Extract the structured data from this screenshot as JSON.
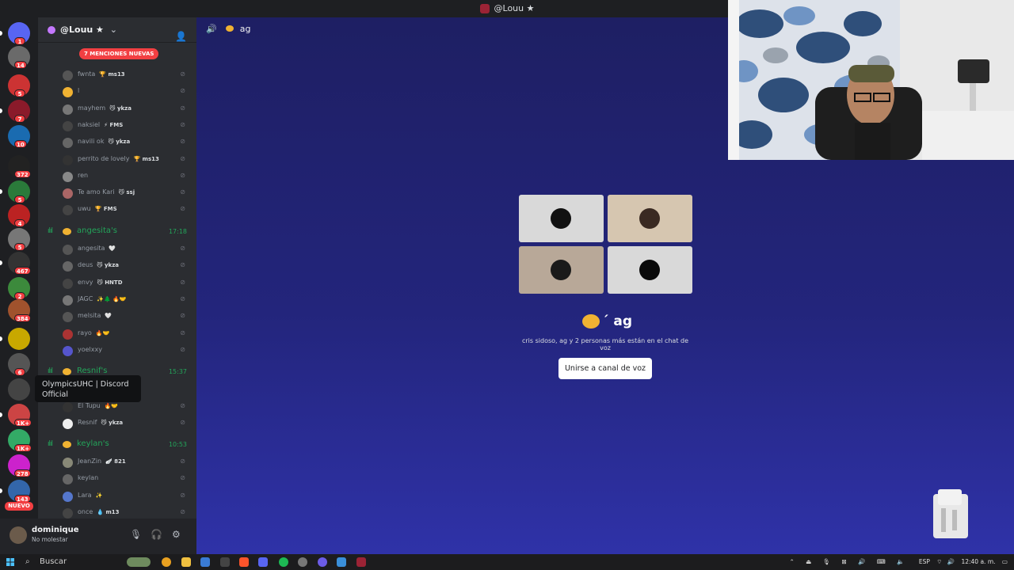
{
  "window": {
    "title": "@Louu ★"
  },
  "rail": {
    "servers": [
      {
        "color": "#5865f2",
        "badge": "1"
      },
      {
        "color": "#6a6a6a",
        "badge": "14"
      },
      {
        "color": "#c33",
        "badge": "5"
      },
      {
        "color": "#8a1a2a",
        "badge": "7"
      },
      {
        "color": "#1a6bb0",
        "badge": "10"
      },
      {
        "color": "#222",
        "badge": "372"
      },
      {
        "color": "#2a7a3a",
        "badge": "5"
      },
      {
        "color": "#b22",
        "badge": "4"
      },
      {
        "color": "#777",
        "badge": "5"
      },
      {
        "color": "#333",
        "badge": "467"
      },
      {
        "color": "#3c8a3c",
        "badge": "2"
      },
      {
        "color": "#a0522d",
        "badge": "384"
      },
      {
        "color": "#c8a800",
        "badge": ""
      },
      {
        "color": "#555",
        "badge": "6"
      },
      {
        "color": "#444",
        "badge": ""
      },
      {
        "color": "#c44",
        "badge": "1K+"
      },
      {
        "color": "#3a6",
        "badge": "1K+"
      },
      {
        "color": "#c2c",
        "badge": "278"
      },
      {
        "color": "#36a",
        "badge": "143"
      }
    ],
    "new_label": "NUEVO"
  },
  "guild": {
    "name": "@Louu ★",
    "mentions_pill": "7 MENCIONES NUEVAS"
  },
  "voice_members_top": [
    {
      "name": "fwnta",
      "tag": "🏆 ms13",
      "color": "#555"
    },
    {
      "name": "l",
      "tag": "",
      "color": "#f0b232"
    },
    {
      "name": "mayhem",
      "tag": "😼 ykza",
      "color": "#777"
    },
    {
      "name": "naksiel",
      "tag": "⚡ FMS",
      "color": "#444"
    },
    {
      "name": "navili ok",
      "tag": "😼 ykza",
      "color": "#666"
    },
    {
      "name": "perrito de lovely",
      "tag": "🏆 ms13",
      "color": "#333"
    },
    {
      "name": "ren",
      "tag": "",
      "color": "#888"
    },
    {
      "name": "Te amo Kari",
      "tag": "😼 ssj",
      "color": "#a66"
    },
    {
      "name": "uwu",
      "tag": "🏆 FMS",
      "color": "#444"
    }
  ],
  "channel_angesita": {
    "name": "angesita's",
    "time": "17:18"
  },
  "members_angesita": [
    {
      "name": "angesita",
      "tag": "🤍",
      "color": "#555"
    },
    {
      "name": "deus",
      "tag": "😼 ykza",
      "color": "#666"
    },
    {
      "name": "envy",
      "tag": "😼 HNTD",
      "color": "#444"
    },
    {
      "name": "JAGC",
      "tag": "✨🌲 🔥🤝",
      "color": "#777"
    },
    {
      "name": "melsita",
      "tag": "🤍",
      "color": "#555"
    },
    {
      "name": "rayo",
      "tag": "🔥🤝",
      "color": "#a33"
    },
    {
      "name": "yoelxxy",
      "tag": "",
      "color": "#55c"
    }
  ],
  "channel_resnif": {
    "name": "Resnif's",
    "time": "15:37"
  },
  "members_resnif": [
    {
      "name": "El Tupu",
      "tag": "🔥🤝",
      "color": "#333"
    },
    {
      "name": "Resnif",
      "tag": "😼 ykza",
      "color": "#eee"
    }
  ],
  "channel_keylan": {
    "name": "keylan's",
    "time": "10:53"
  },
  "members_keylan": [
    {
      "name": "JeanZin",
      "tag": "🪽 821",
      "color": "#887"
    },
    {
      "name": "keylan",
      "tag": "",
      "color": "#666"
    },
    {
      "name": "Lara",
      "tag": "✨",
      "color": "#57c"
    },
    {
      "name": "once",
      "tag": "💧 m13",
      "color": "#444"
    }
  ],
  "tooltip": {
    "text": "OlympicsUHC | Discord Official"
  },
  "user": {
    "name": "dominique",
    "status": "No molestar"
  },
  "stage": {
    "channel_name": "ag",
    "tiles": [
      {
        "bg": "#d9d9d9",
        "avatar": "#111"
      },
      {
        "bg": "#d6c6b0",
        "avatar": "#3a2a22"
      },
      {
        "bg": "#b8a898",
        "avatar": "#1a1a1a"
      },
      {
        "bg": "#d9d9d9",
        "avatar": "#0a0a0a"
      }
    ],
    "title": "´ ag",
    "description": "cris sidoso, ag y 2 personas más están en el chat de voz",
    "join_button": "Unirse a canal de voz"
  },
  "taskbar": {
    "search_label": "Buscar",
    "language": "ESP",
    "clock": "12:40 a. m."
  }
}
